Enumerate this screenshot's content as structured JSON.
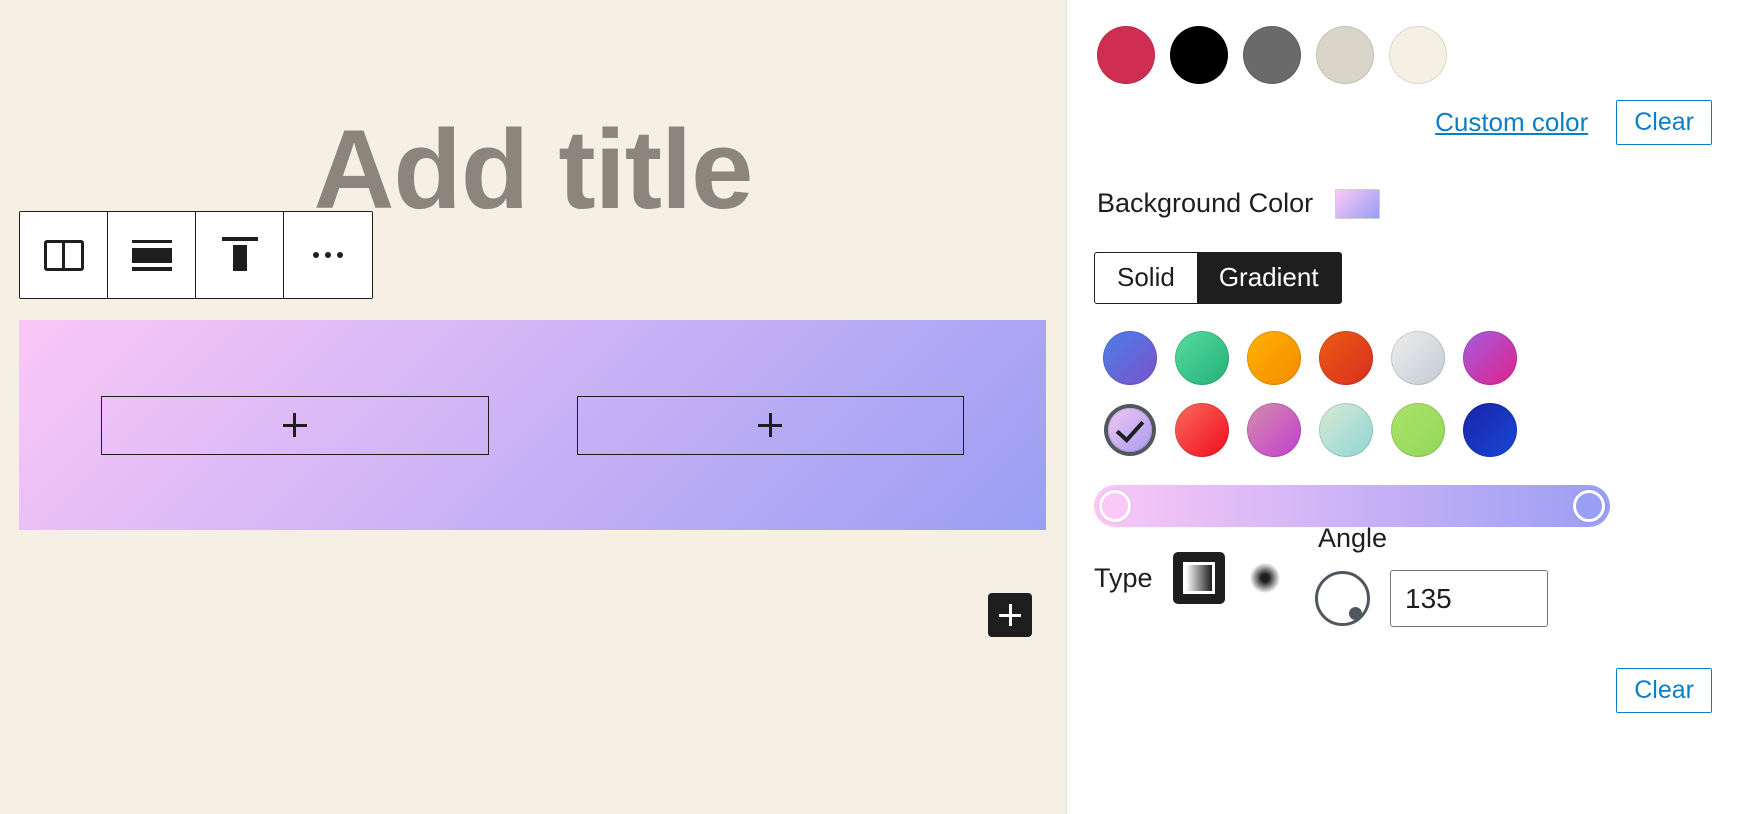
{
  "editor": {
    "title_placeholder": "Add title",
    "block_toolbar": {
      "buttons": [
        {
          "name": "columns-block-icon",
          "label": "Columns"
        },
        {
          "name": "change-alignment-icon",
          "label": "Change alignment"
        },
        {
          "name": "vertical-align-top-icon",
          "label": "Vertical align top"
        },
        {
          "name": "more-options-icon",
          "label": "Options"
        }
      ]
    },
    "cover": {
      "background_gradient": "linear-gradient(135deg, #fbc7f7 0%, #9a9ef4 100%)",
      "columns": [
        {
          "appender_label": "+"
        },
        {
          "appender_label": "+"
        }
      ]
    },
    "appender_label": "+"
  },
  "sidebar": {
    "palette": {
      "swatches": [
        {
          "name": "swatch-crimson",
          "color": "#cf2e52"
        },
        {
          "name": "swatch-black",
          "color": "#000000"
        },
        {
          "name": "swatch-dark-gray",
          "color": "#6a6a6a"
        },
        {
          "name": "swatch-light-gray",
          "color": "#d9d6c9"
        },
        {
          "name": "swatch-cream",
          "color": "#f5efe4"
        }
      ],
      "custom_color_label": "Custom color",
      "clear_label": "Clear"
    },
    "background_color": {
      "label": "Background Color",
      "swatch_gradient": "linear-gradient(135deg, #fbc7f7 0%, #9a9ef4 100%)"
    },
    "style_toggle": {
      "options": [
        {
          "label": "Solid",
          "active": false
        },
        {
          "label": "Gradient",
          "active": true
        }
      ]
    },
    "gradients": [
      {
        "name": "gradient-vivid-cyan-blue-to-vivid-purple",
        "css": "linear-gradient(135deg, #4a80e8 0%, #7b51cc 100%)",
        "selected": false
      },
      {
        "name": "gradient-light-green-cyan-to-vivid-green-cyan",
        "css": "linear-gradient(135deg, #59dca0 0%, #22b077 100%)",
        "selected": false
      },
      {
        "name": "gradient-luminous-vivid-amber-to-luminous-vivid-orange",
        "css": "linear-gradient(135deg, #ffb300 0%, #f58a00 100%)",
        "selected": false
      },
      {
        "name": "gradient-luminous-vivid-orange-to-vivid-red",
        "css": "linear-gradient(135deg, #ef5b15 0%, #d62e1f 100%)",
        "selected": false
      },
      {
        "name": "gradient-very-light-gray-to-cyan-bluish-gray",
        "css": "linear-gradient(135deg, #eeeeee 0%, #c3cbd2 100%)",
        "selected": false
      },
      {
        "name": "gradient-cool-to-warm-spectrum",
        "css": "linear-gradient(135deg, #a45ee0 0%, #e0218a 100%)",
        "selected": false
      },
      {
        "name": "gradient-pale-pink-to-light-purple",
        "css": "linear-gradient(135deg, #f0c9f4 0%, #a89af0 100%)",
        "selected": true
      },
      {
        "name": "gradient-blush-light-purple-to-red",
        "css": "linear-gradient(135deg, #fb6b5c 0%, #f00b1f 100%)",
        "selected": false
      },
      {
        "name": "gradient-blush-bordeaux",
        "css": "linear-gradient(135deg, #d48dad 0%, #c23ed0 100%)",
        "selected": false
      },
      {
        "name": "gradient-luminous-dusk",
        "css": "linear-gradient(135deg, #d9ead3 0%, #8fd5d8 100%)",
        "selected": false
      },
      {
        "name": "gradient-pale-ocean",
        "css": "linear-gradient(135deg, #abe36a 0%, #93d65b 100%)",
        "selected": false
      },
      {
        "name": "gradient-electric-grass",
        "css": "linear-gradient(135deg, #1b22a8 0%, #1648d6 100%)",
        "selected": false
      }
    ],
    "gradient_bar": {
      "css": "linear-gradient(90deg, #fbc7f7 0%, #9a9ef4 100%)",
      "start_handle_color": "#fbc7f7",
      "end_handle_color": "#9a9ef4"
    },
    "type": {
      "label": "Type",
      "options": [
        {
          "name": "linear-gradient-type-icon",
          "label": "Linear",
          "selected": true
        },
        {
          "name": "radial-gradient-type-icon",
          "label": "Radial",
          "selected": false
        }
      ]
    },
    "angle": {
      "label": "Angle",
      "value": "135"
    },
    "bottom_clear_label": "Clear"
  }
}
